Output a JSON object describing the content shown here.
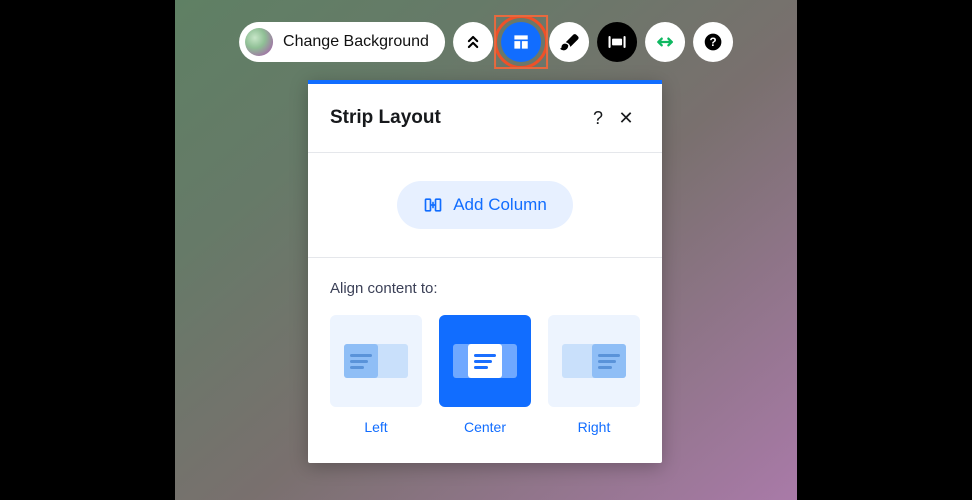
{
  "toolbar": {
    "change_bg_label": "Change Background"
  },
  "panel": {
    "title": "Strip Layout",
    "help_glyph": "?",
    "close_glyph": "✕",
    "add_column_label": "Add Column",
    "align_label": "Align content to:",
    "align_options": {
      "left": "Left",
      "center": "Center",
      "right": "Right"
    },
    "selected_align": "center"
  },
  "colors": {
    "accent": "#116dff",
    "highlight_border": "#e8693e"
  }
}
